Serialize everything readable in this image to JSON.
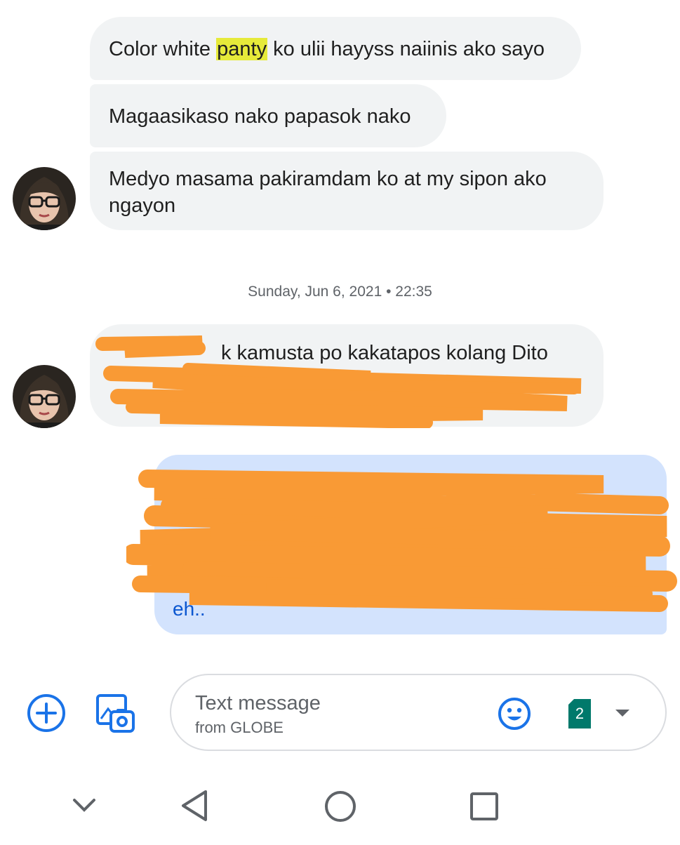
{
  "conversation": {
    "received_group_1": [
      {
        "before": "Color white ",
        "highlight": "panty",
        "after": " ko ulii hayyss naiinis ako sayo"
      },
      {
        "before": "Magaasikaso nako papasok nako",
        "highlight": "",
        "after": ""
      },
      {
        "before": "Medyo masama pakiramdam ko at my sipon ako ngayon",
        "highlight": "",
        "after": ""
      }
    ],
    "date_separator": "Sunday, Jun 6, 2021 • 22:35",
    "received_group_2": {
      "visible_text_line1": "k kamusta po kakatapos kolang Dito",
      "redacted": true
    },
    "sent_message": {
      "visible_tail": "eh..",
      "redacted": true
    }
  },
  "composer": {
    "placeholder": "Text message",
    "sub_label": "from GLOBE",
    "sim_number": "2",
    "icons": [
      "add-icon",
      "gallery-icon",
      "emoji-icon",
      "sim-card-icon",
      "dropdown-arrow-icon"
    ]
  },
  "navbar": {
    "icons": [
      "nav-down-icon",
      "nav-back-icon",
      "nav-home-icon",
      "nav-recents-icon"
    ]
  },
  "colors": {
    "accent": "#1a73e8",
    "received_bubble": "#f1f3f4",
    "sent_bubble": "#d3e3fd",
    "redaction": "#f99a35",
    "sim_badge": "#00796b",
    "highlight": "#e6ea3a"
  }
}
